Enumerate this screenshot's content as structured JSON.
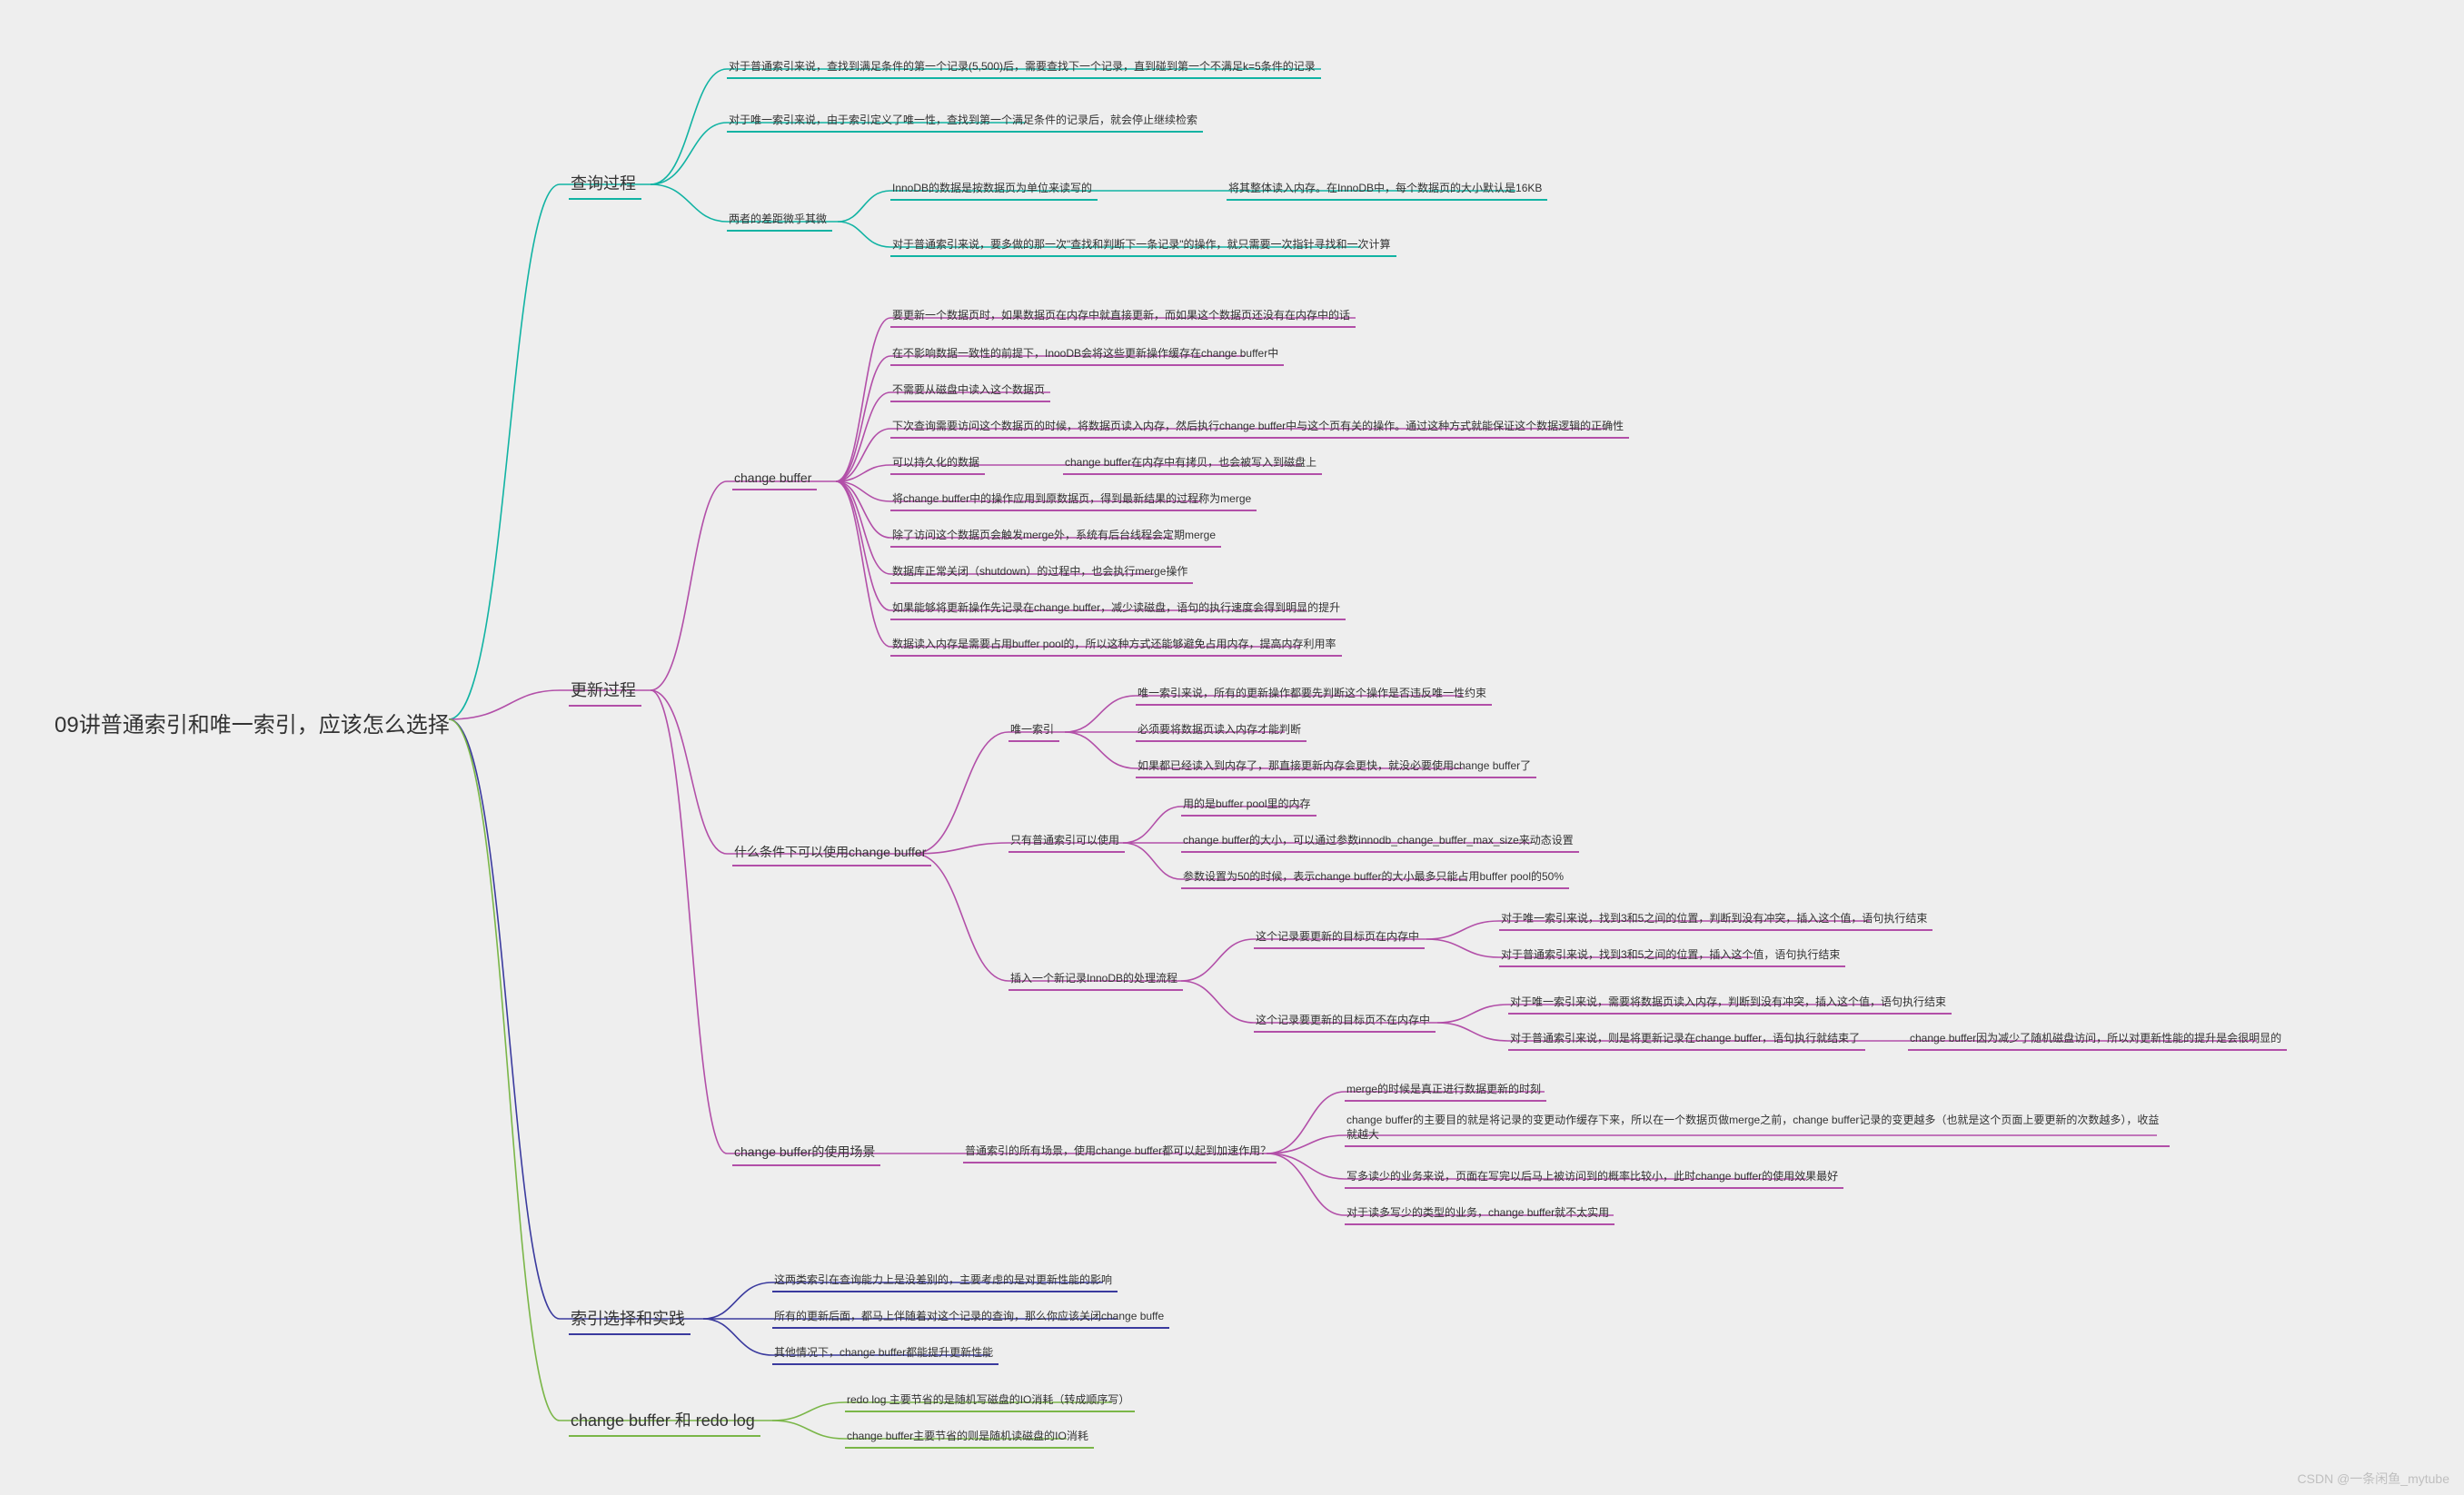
{
  "root": "09讲普通索引和唯一索引，应该怎么选择",
  "credit": "CSDN @一条闲鱼_mytube",
  "n": {
    "q": "查询过程",
    "q1": "对于普通索引来说，查找到满足条件的第一个记录(5,500)后，需要查找下一个记录，直到碰到第一个不满足k=5条件的记录",
    "q2": "对于唯一索引来说，由于索引定义了唯一性，查找到第一个满足条件的记录后，就会停止继续检索",
    "q3": "两者的差距微乎其微",
    "q31": "InnoDB的数据是按数据页为单位来读写的",
    "q31b": "将其整体读入内存。在InnoDB中，每个数据页的大小默认是16KB",
    "q32": "对于普通索引来说，要多做的那一次\"查找和判断下一条记录\"的操作，就只需要一次指针寻找和一次计算",
    "u": "更新过程",
    "cb": "change buffer",
    "cb1": "要更新一个数据页时，如果数据页在内存中就直接更新，而如果这个数据页还没有在内存中的话",
    "cb2": "在不影响数据一致性的前提下，InooDB会将这些更新操作缓存在change buffer中",
    "cb3": "不需要从磁盘中读入这个数据页",
    "cb4": "下次查询需要访问这个数据页的时候，将数据页读入内存，然后执行change buffer中与这个页有关的操作。通过这种方式就能保证这个数据逻辑的正确性",
    "cb5": "可以持久化的数据",
    "cb5b": "change buffer在内存中有拷贝，也会被写入到磁盘上",
    "cb6": "将change buffer中的操作应用到原数据页，得到最新结果的过程称为merge",
    "cb7": "除了访问这个数据页会触发merge外，系统有后台线程会定期merge",
    "cb8": "数据库正常关闭（shutdown）的过程中，也会执行merge操作",
    "cb9": "如果能够将更新操作先记录在change buffer，减少读磁盘，语句的执行速度会得到明显的提升",
    "cb10": "数据读入内存是需要占用buffer pool的，所以这种方式还能够避免占用内存，提高内存利用率",
    "cond": "什么条件下可以使用change buffer",
    "uq": "唯一索引",
    "uq1": "唯一索引来说，所有的更新操作都要先判断这个操作是否违反唯一性约束",
    "uq2": "必须要将数据页读入内存才能判断",
    "uq3": "如果都已经读入到内存了，那直接更新内存会更快，就没必要使用change buffer了",
    "only": "只有普通索引可以使用",
    "only1": "用的是buffer pool里的内存",
    "only2": "change buffer的大小，可以通过参数innodb_change_buffer_max_size来动态设置",
    "only3": "参数设置为50的时候，表示change buffer的大小最多只能占用buffer pool的50%",
    "ins": "插入一个新记录InnoDB的处理流程",
    "ins_in": "这个记录要更新的目标页在内存中",
    "ins_in1": "对于唯一索引来说，找到3和5之间的位置，判断到没有冲突，插入这个值，语句执行结束",
    "ins_in2": "对于普通索引来说，找到3和5之间的位置，插入这个值，语句执行结束",
    "ins_out": "这个记录要更新的目标页不在内存中",
    "ins_out1": "对于唯一索引来说，需要将数据页读入内存，判断到没有冲突，插入这个值，语句执行结束",
    "ins_out2": "对于普通索引来说，则是将更新记录在change buffer，语句执行就结束了",
    "ins_out2b": "change buffer因为减少了随机磁盘访问，所以对更新性能的提升是会很明显的",
    "scene": "change buffer的使用场景",
    "scene_q": "普通索引的所有场景，使用change buffer都可以起到加速作用？",
    "scene1": "merge的时候是真正进行数据更新的时刻",
    "scene2": "change buffer的主要目的就是将记录的变更动作缓存下来，所以在一个数据页做merge之前，change buffer记录的变更越多（也就是这个页面上要更新的次数越多），收益就越大",
    "scene3": "写多读少的业务来说，页面在写完以后马上被访问到的概率比较小，此时change buffer的使用效果最好",
    "scene4": "对于读多写少的类型的业务，change buffer就不太实用",
    "sel": "索引选择和实践",
    "sel1": "这两类索引在查询能力上是没差别的，主要考虑的是对更新性能的影响",
    "sel2": "所有的更新后面，都马上伴随着对这个记录的查询，那么你应该关闭change buffe",
    "sel3": "其他情况下，change buffer都能提升更新性能",
    "redo": "change buffer 和 redo log",
    "redo1": "redo log 主要节省的是随机写磁盘的IO消耗（转成顺序写）",
    "redo2": "change buffer主要节省的则是随机读磁盘的IO消耗"
  },
  "colors": {
    "teal": "#11b3a3",
    "purple": "#b24fa8",
    "indigo": "#3a3a9e",
    "green": "#7ab648"
  }
}
